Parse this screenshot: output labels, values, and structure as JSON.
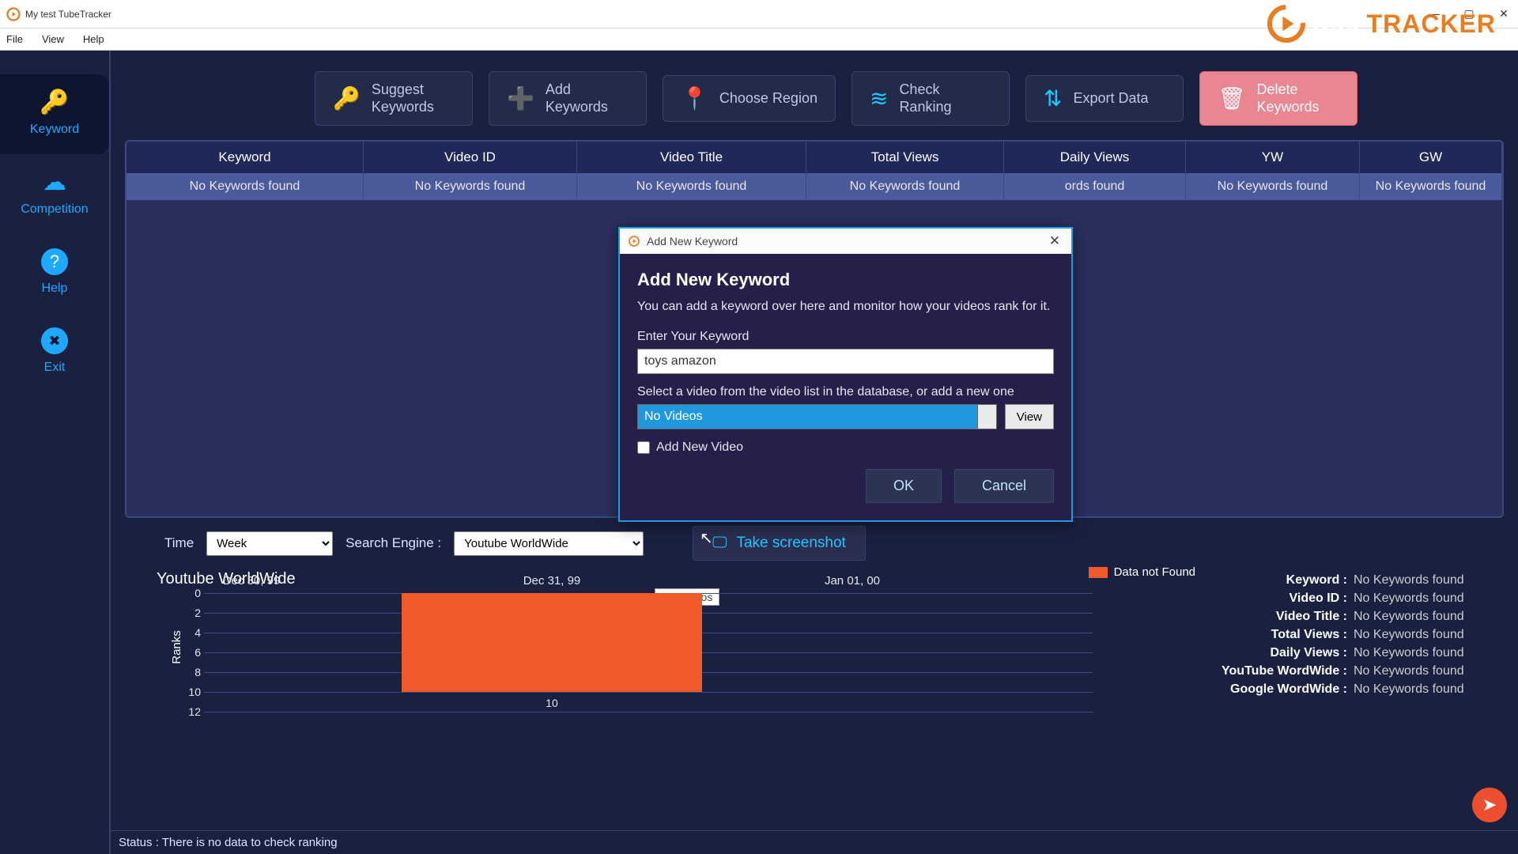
{
  "window": {
    "title": "My test TubeTracker"
  },
  "menubar": [
    "File",
    "View",
    "Help"
  ],
  "brand": {
    "prefix": "Tube",
    "suffix": "TRACKER"
  },
  "sidebar": [
    {
      "label": "Keyword",
      "icon": "🔑"
    },
    {
      "label": "Competition",
      "icon": "☁"
    },
    {
      "label": "Help",
      "icon": "?"
    },
    {
      "label": "Exit",
      "icon": "✖"
    }
  ],
  "toolbar": [
    {
      "label": "Suggest\nKeywords",
      "icon": "🔑"
    },
    {
      "label": "Add\nKeywords",
      "icon": "➕"
    },
    {
      "label": "Choose Region",
      "icon": "📍"
    },
    {
      "label": "Check\nRanking",
      "icon": "≋"
    },
    {
      "label": "Export Data",
      "icon": "⇅"
    },
    {
      "label": "Delete\nKeywords",
      "icon": "🗑"
    }
  ],
  "table": {
    "headers": [
      "Keyword",
      "Video ID",
      "Video Title",
      "Total Views",
      "Daily Views",
      "YW",
      "GW"
    ],
    "row": [
      "No Keywords found",
      "No Keywords found",
      "No Keywords found",
      "No Keywords found",
      "ords found",
      "No Keywords found",
      "No Keywords found"
    ]
  },
  "controls": {
    "time_label": "Time",
    "time_value": "Week",
    "engine_label": "Search Engine :",
    "engine_value": "Youtube WorldWide",
    "screenshot": "Take screenshot"
  },
  "info": [
    {
      "label": "Keyword :",
      "value": "No Keywords found"
    },
    {
      "label": "Video ID :",
      "value": "No Keywords found"
    },
    {
      "label": "Video Title :",
      "value": "No Keywords found"
    },
    {
      "label": "Total Views :",
      "value": "No Keywords found"
    },
    {
      "label": "Daily Views :",
      "value": "No Keywords found"
    },
    {
      "label": "YouTube WordWide :",
      "value": "No Keywords found"
    },
    {
      "label": "Google WordWide :",
      "value": "No Keywords found"
    }
  ],
  "status": "Status : There is no data to check ranking",
  "dialog": {
    "title_small": "Add New Keyword",
    "heading": "Add New Keyword",
    "desc": "You can add a keyword over here and monitor how your videos rank for it.",
    "enter_label": "Enter Your Keyword",
    "keyword_value": "toys amazon",
    "select_label": "Select a video from the video list in the database, or add a new one",
    "combo_value": "No Videos",
    "view": "View",
    "checkbox": "Add New Video",
    "ok": "OK",
    "cancel": "Cancel"
  },
  "chart_data": {
    "type": "bar",
    "title": "Youtube WorldWide",
    "ylabel": "Ranks",
    "ylim": [
      0,
      12
    ],
    "yticks": [
      0,
      2,
      4,
      6,
      8,
      10,
      12
    ],
    "categories": [
      "Dec 30, 99",
      "Dec 31, 99",
      "Jan 01, 00"
    ],
    "values": [
      null,
      10,
      null
    ],
    "legend": "Data not Found",
    "tooltip": "No Videos"
  }
}
